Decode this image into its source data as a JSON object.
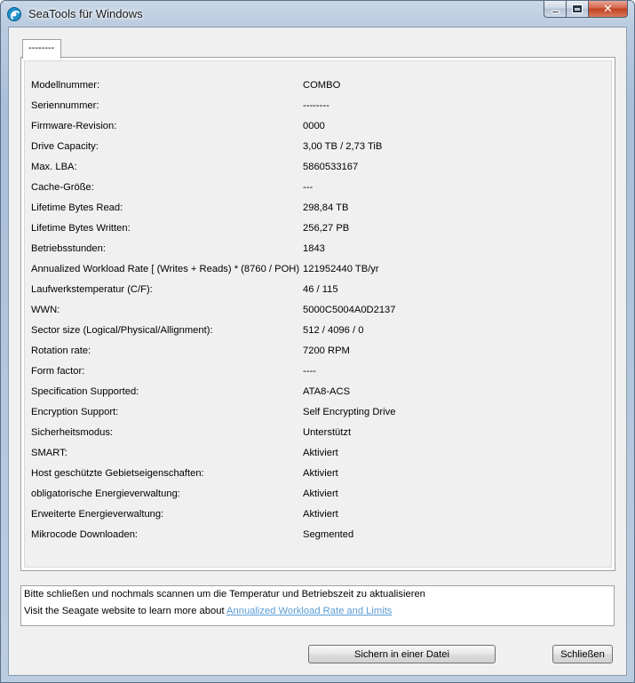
{
  "window": {
    "title": "SeaTools für Windows",
    "close_glyph": "✕"
  },
  "tab": {
    "label": "--------"
  },
  "details": [
    {
      "label": "Modellnummer:",
      "value": "COMBO"
    },
    {
      "label": "Seriennummer:",
      "value": "--------"
    },
    {
      "label": "Firmware-Revision:",
      "value": "0000"
    },
    {
      "label": "Drive Capacity:",
      "value": "3,00 TB / 2,73 TiB"
    },
    {
      "label": "Max. LBA:",
      "value": "5860533167"
    },
    {
      "label": "Cache-Größe:",
      "value": "---"
    },
    {
      "label": "Lifetime Bytes Read:",
      "value": "298,84  TB"
    },
    {
      "label": "Lifetime Bytes Written:",
      "value": "256,27  PB"
    },
    {
      "label": "Betriebsstunden:",
      "value": "1843"
    },
    {
      "label": "Annualized Workload Rate [ (Writes + Reads) * (8760 / POH)",
      "value": "121952440 TB/yr"
    },
    {
      "label": "Laufwerkstemperatur (C/F):",
      "value": "46 / 115"
    },
    {
      "label": "WWN:",
      "value": "5000C5004A0D2137"
    },
    {
      "label": "Sector size (Logical/Physical/Allignment):",
      "value": "512 / 4096 / 0"
    },
    {
      "label": "Rotation rate:",
      "value": "7200 RPM"
    },
    {
      "label": "Form factor:",
      "value": "----"
    },
    {
      "label": "Specification Supported:",
      "value": "ATA8-ACS"
    },
    {
      "label": "Encryption Support:",
      "value": "Self Encrypting Drive"
    },
    {
      "label": "Sicherheitsmodus:",
      "value": "Unterstützt"
    },
    {
      "label": "SMART:",
      "value": "Aktiviert"
    },
    {
      "label": "Host geschützte Gebietseigenschaften:",
      "value": "Aktiviert"
    },
    {
      "label": "obligatorische Energieverwaltung:",
      "value": "Aktiviert"
    },
    {
      "label": "Erweiterte Energieverwaltung:",
      "value": "Aktiviert"
    },
    {
      "label": "Mikrocode  Downloaden:",
      "value": "Segmented"
    }
  ],
  "info": {
    "line1": "Bitte schließen und nochmals scannen um die Temperatur und Betriebszeit zu aktualisieren",
    "line2_prefix": "Visit the Seagate website to learn more about ",
    "link_text": "Annualized Workload Rate and Limits"
  },
  "buttons": {
    "save": "Sichern in einer Datei",
    "close": "Schließen"
  },
  "colors": {
    "link": "#5b9bd5",
    "close_button": "#c2401f"
  }
}
